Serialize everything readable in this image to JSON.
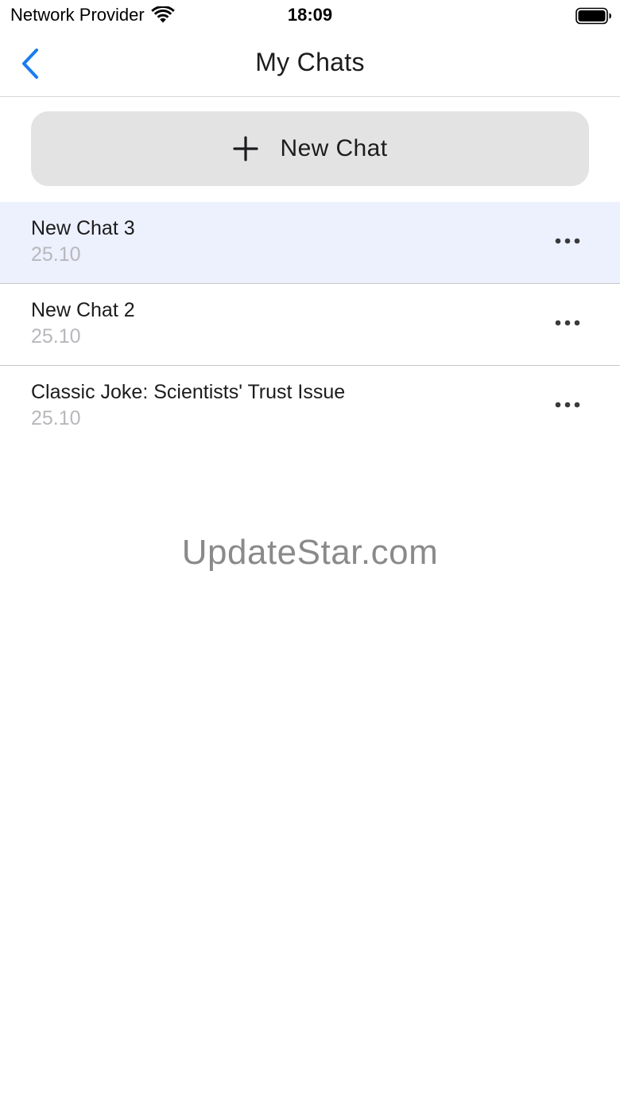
{
  "status_bar": {
    "carrier": "Network Provider",
    "time": "18:09",
    "icons": [
      "wifi-icon",
      "battery-icon"
    ]
  },
  "nav": {
    "title": "My Chats",
    "back_icon": "chevron-left-icon",
    "accent_color": "#1a7cf0"
  },
  "new_chat": {
    "label": "New Chat",
    "icon": "plus-icon"
  },
  "chats": [
    {
      "title": "New Chat 3",
      "date": "25.10",
      "selected": true
    },
    {
      "title": "New Chat 2",
      "date": "25.10",
      "selected": false
    },
    {
      "title": "Classic Joke: Scientists' Trust Issue",
      "date": "25.10",
      "selected": false
    }
  ],
  "watermark": "UpdateStar.com"
}
